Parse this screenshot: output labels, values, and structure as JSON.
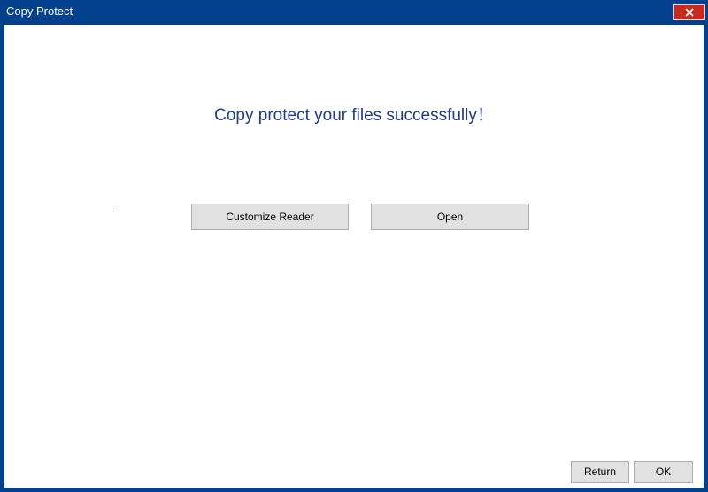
{
  "window": {
    "title": "Copy Protect",
    "close_icon": "close-icon",
    "accent_color": "#00408c",
    "close_color": "#c42b1c"
  },
  "main": {
    "headline": "Copy protect your files successfully！",
    "headline_color": "#1f3b8c",
    "customize_label": "Customize Reader",
    "open_label": "Open"
  },
  "footer": {
    "return_label": "Return",
    "ok_label": "OK"
  }
}
